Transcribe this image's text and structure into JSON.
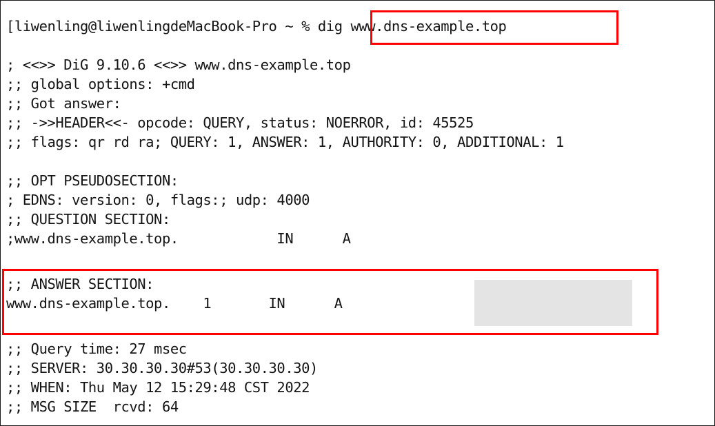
{
  "terminal": {
    "prompt_line": {
      "prompt": "[liwenling@liwenlingdeMacBook-Pro ~ % ",
      "command": "dig www.dns-example.top"
    },
    "lines": [
      {
        "id": "dig-version",
        "text": "; <<>> DiG 9.10.6 <<>> www.dns-example.top"
      },
      {
        "id": "global-options",
        "text": ";; global options: +cmd"
      },
      {
        "id": "got-answer",
        "text": ";; Got answer:"
      },
      {
        "id": "header",
        "text": ";; ->>HEADER<<- opcode: QUERY, status: NOERROR, id: 45525"
      },
      {
        "id": "flags",
        "text": ";; flags: qr rd ra; QUERY: 1, ANSWER: 1, AUTHORITY: 0, ADDITIONAL: 1"
      },
      {
        "id": "blank-1",
        "text": " "
      },
      {
        "id": "opt-pseudosection",
        "text": ";; OPT PSEUDOSECTION:"
      },
      {
        "id": "edns",
        "text": "; EDNS: version: 0, flags:; udp: 4000"
      },
      {
        "id": "question-header",
        "text": ";; QUESTION SECTION:"
      },
      {
        "id": "question-record",
        "text": ";www.dns-example.top.            IN      A"
      },
      {
        "id": "blank-2",
        "text": " "
      },
      {
        "id": "answer-header",
        "text": ";; ANSWER SECTION:"
      },
      {
        "id": "answer-record",
        "text": "www.dns-example.top.    1       IN      A"
      },
      {
        "id": "blank-3",
        "text": " "
      },
      {
        "id": "query-time",
        "text": ";; Query time: 27 msec"
      },
      {
        "id": "server",
        "text": ";; SERVER: 30.30.30.30#53(30.30.30.30)"
      },
      {
        "id": "when",
        "text": ";; WHEN: Thu May 12 15:29:48 CST 2022"
      },
      {
        "id": "msg-size",
        "text": ";; MSG SIZE  rcvd: 64"
      }
    ]
  },
  "annotations": {
    "highlight_color": "#ff0000",
    "redaction_color": "#e4e4e4",
    "command_box_label": "dig www.dns-example.top",
    "answer_box_label": ";; ANSWER SECTION:"
  }
}
